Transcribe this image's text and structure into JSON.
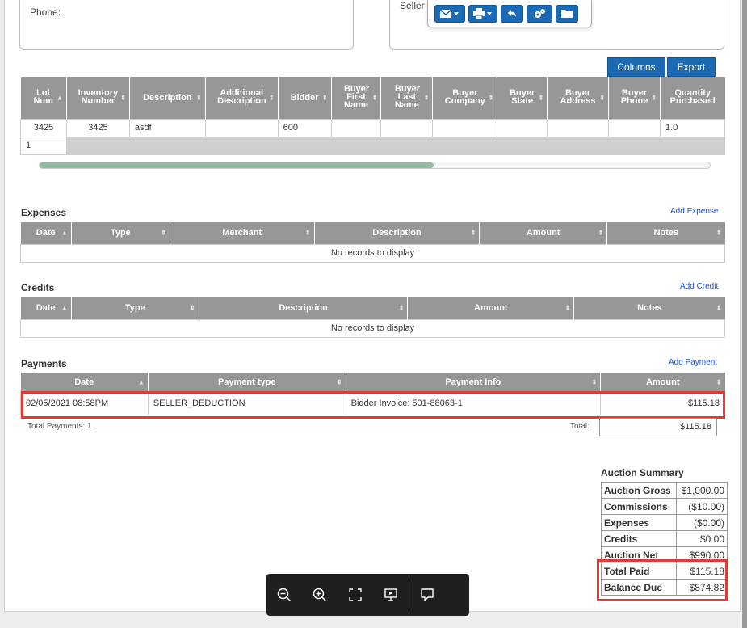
{
  "contact": {
    "phone_label": "Phone:",
    "seller_label": "Seller"
  },
  "toolbar_icons": [
    "email-icon",
    "print-icon",
    "undo-icon",
    "settings-icon",
    "folder-icon"
  ],
  "lots": {
    "columns_button": "Columns",
    "export_button": "Export",
    "headers": [
      "Lot Num",
      "Inventory Number",
      "Description",
      "Additional Description",
      "Bidder",
      "Buyer First Name",
      "Buyer Last Name",
      "Buyer Company",
      "Buyer State",
      "Buyer Address",
      "Buyer Phone",
      "Quantity Purchased"
    ],
    "rows": [
      [
        "3425",
        "3425",
        "asdf",
        "",
        "600",
        "",
        "",
        "",
        "",
        "",
        "",
        "1.0"
      ]
    ],
    "pager_page": "1"
  },
  "expenses": {
    "title": "Expenses",
    "add_link": "Add Expense",
    "headers": [
      "Date",
      "Type",
      "Merchant",
      "Description",
      "Amount",
      "Notes"
    ],
    "empty": "No records to display"
  },
  "credits": {
    "title": "Credits",
    "add_link": "Add Credit",
    "headers": [
      "Date",
      "Type",
      "Description",
      "Amount",
      "Notes"
    ],
    "empty": "No records to display"
  },
  "payments": {
    "title": "Payments",
    "add_link": "Add Payment",
    "headers": [
      "Date",
      "Payment type",
      "Payment Info",
      "Amount"
    ],
    "rows": [
      [
        "02/05/2021 08:58PM",
        "SELLER_DEDUCTION",
        "Bidder Invoice: 501-88063-1",
        "$115.18"
      ]
    ],
    "total_count": "Total Payments: 1",
    "total_label": "Total:",
    "total_value": "$115.18"
  },
  "summary": {
    "title": "Auction Summary",
    "rows": [
      {
        "label": "Auction Gross",
        "value": "$1,000.00"
      },
      {
        "label": "Commissions",
        "value": "($10.00)"
      },
      {
        "label": "Expenses",
        "value": "($0.00)"
      },
      {
        "label": "Credits",
        "value": "$0.00"
      },
      {
        "label": "Auction Net",
        "value": "$990.00"
      },
      {
        "label": "Total Paid",
        "value": "$115.18"
      },
      {
        "label": "Balance Due",
        "value": "$874.82"
      }
    ]
  },
  "viewer_icons": [
    "zoom-out-icon",
    "zoom-in-icon",
    "fullscreen-icon",
    "present-icon",
    "comment-icon"
  ],
  "colors": {
    "accent": "#1b6ab3",
    "header_gray": "#979797",
    "highlight_red": "#e53935",
    "link": "#1b4fd6"
  }
}
